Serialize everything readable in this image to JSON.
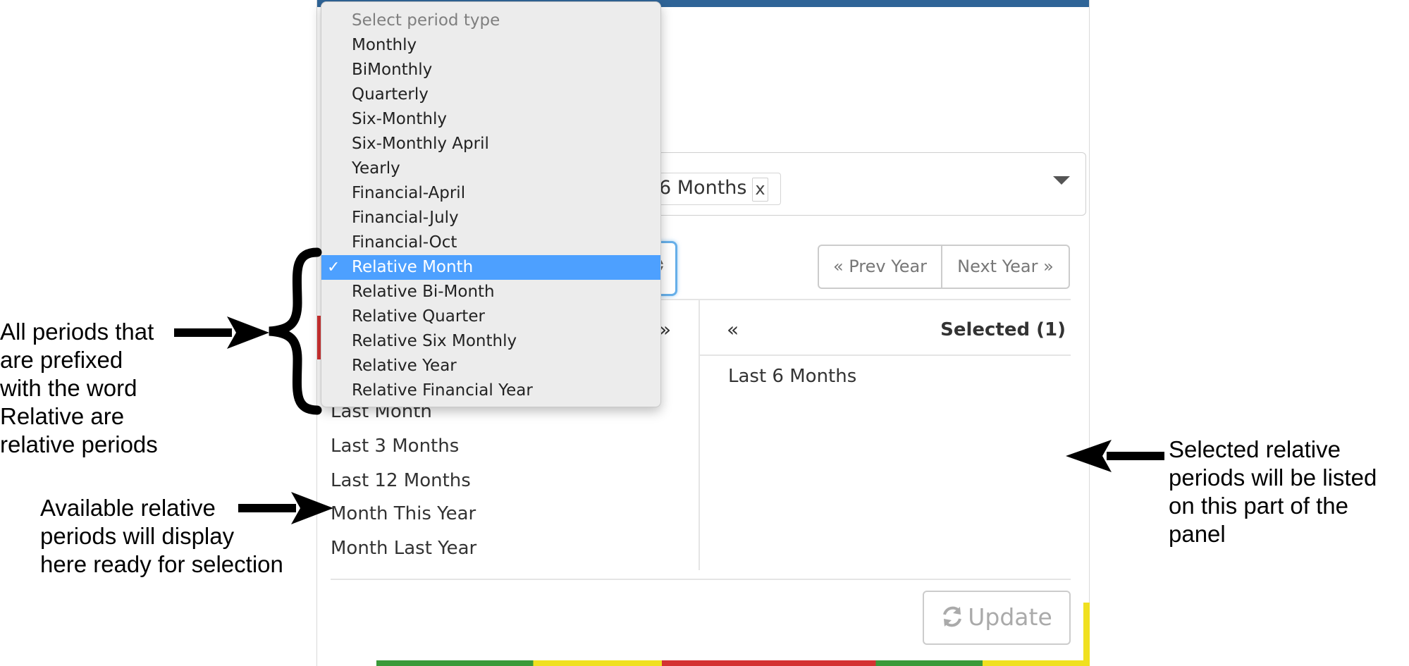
{
  "period_selector": {
    "chip_label": "6 Months",
    "chip_remove": "x"
  },
  "period_type_dropdown": {
    "header": "Select period type",
    "options": [
      "Monthly",
      "BiMonthly",
      "Quarterly",
      "Six-Monthly",
      "Six-Monthly April",
      "Yearly",
      "Financial-April",
      "Financial-July",
      "Financial-Oct",
      "Relative Month",
      "Relative Bi-Month",
      "Relative Quarter",
      "Relative Six Monthly",
      "Relative Year",
      "Relative Financial Year"
    ],
    "selected": "Relative Month",
    "check_glyph": "✓"
  },
  "year_nav": {
    "prev": "« Prev Year",
    "next": "Next Year »"
  },
  "available": {
    "select_all_icon": "»",
    "items": [
      "Last Month",
      "Last 3 Months",
      "Last 12 Months",
      "Month This Year",
      "Month Last Year"
    ]
  },
  "selected": {
    "deselect_all_icon": "«",
    "header": "Selected (1)",
    "items": [
      "Last 6 Months"
    ]
  },
  "update_button": {
    "label": "Update"
  },
  "annotations": {
    "left_top": [
      "All periods that",
      "are prefixed",
      "with the word",
      "Relative are",
      "relative periods"
    ],
    "left_bottom": [
      "Available relative",
      "periods will display",
      "here ready for selection"
    ],
    "right": [
      "Selected relative",
      "periods will be listed",
      "on this part of the",
      "panel"
    ]
  },
  "colors": {
    "header_bar": "#2f6497",
    "highlight": "#4da0ff",
    "focus_ring": "#66afe9"
  }
}
